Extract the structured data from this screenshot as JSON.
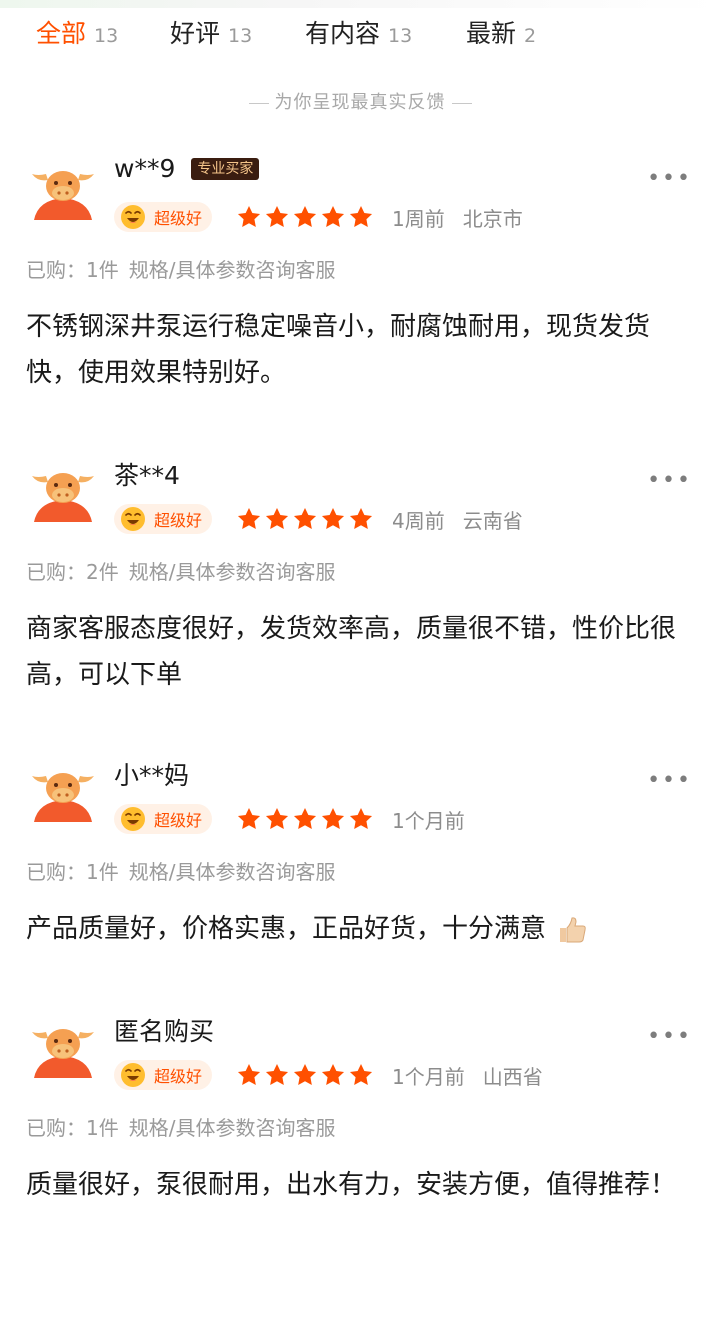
{
  "tabs": [
    {
      "label": "全部",
      "count": "13"
    },
    {
      "label": "好评",
      "count": "13"
    },
    {
      "label": "有内容",
      "count": "13"
    },
    {
      "label": "最新",
      "count": "2"
    }
  ],
  "subtitle": "为你呈现最真实反馈",
  "reviews": [
    {
      "username": "w**9",
      "badge": "专业买家",
      "level": "超级好",
      "time": "1周前",
      "location": "北京市",
      "purchase": "已购：1件",
      "sku": "规格/具体参数咨询客服",
      "content": "不锈钢深井泵运行稳定噪音小，耐腐蚀耐用，现货发货快，使用效果特别好。"
    },
    {
      "username": "茶**4",
      "badge": "",
      "level": "超级好",
      "time": "4周前",
      "location": "云南省",
      "purchase": "已购：2件",
      "sku": "规格/具体参数咨询客服",
      "content": "商家客服态度很好，发货效率高，质量很不错，性价比很高，可以下单"
    },
    {
      "username": "小**妈",
      "badge": "",
      "level": "超级好",
      "time": "1个月前",
      "location": "",
      "purchase": "已购：1件",
      "sku": "规格/具体参数咨询客服",
      "content": "产品质量好，价格实惠，正品好货，十分满意"
    },
    {
      "username": "匿名购买",
      "badge": "",
      "level": "超级好",
      "time": "1个月前",
      "location": "山西省",
      "purchase": "已购：1件",
      "sku": "规格/具体参数咨询客服",
      "content": "质量很好，泵很耐用，出水有力，安装方便，值得推荐！"
    }
  ],
  "colors": {
    "accent": "#ff5000",
    "star": "#ff5000",
    "badge_bg": "#3a1d10",
    "badge_text": "#f5c58a",
    "muted": "#9a9a9a"
  },
  "icons": {
    "avatar": "cow-avatar-icon",
    "level": "smile-face-icon",
    "star": "star-icon",
    "more": "more-dots-icon",
    "thumb": "thumbs-up-icon"
  },
  "rating_stars": 5
}
